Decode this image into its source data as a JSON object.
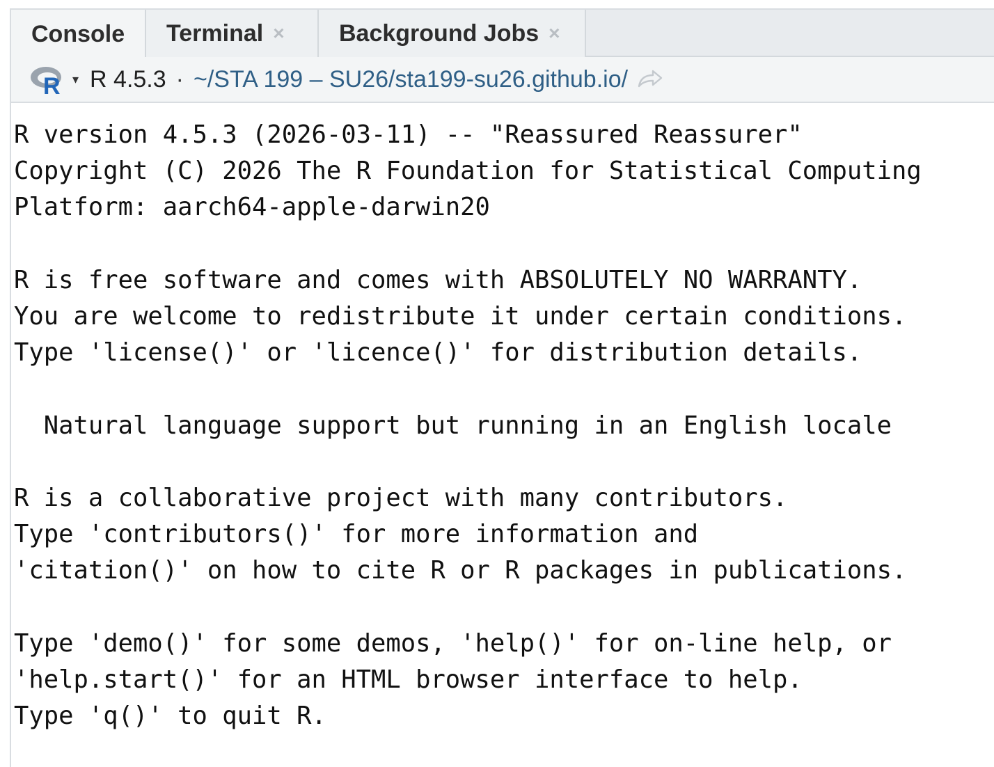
{
  "tabs": [
    {
      "label": "Console",
      "active": true,
      "closable": false
    },
    {
      "label": "Terminal",
      "active": false,
      "closable": true
    },
    {
      "label": "Background Jobs",
      "active": false,
      "closable": true
    }
  ],
  "tab_close_glyph": "×",
  "pathbar": {
    "r_icon": "r-logo-icon",
    "dropdown_glyph": "▾",
    "r_version": "R 4.5.3",
    "separator": "·",
    "path": "~/STA 199 – SU26/sta199-su26.github.io/",
    "goto_icon": "go-to-directory-icon"
  },
  "console": {
    "lines": [
      "R version 4.5.3 (2026-03-11) -- \"Reassured Reassurer\"",
      "Copyright (C) 2026 The R Foundation for Statistical Computing",
      "Platform: aarch64-apple-darwin20",
      "",
      "R is free software and comes with ABSOLUTELY NO WARRANTY.",
      "You are welcome to redistribute it under certain conditions.",
      "Type 'license()' or 'licence()' for distribution details.",
      "",
      "  Natural language support but running in an English locale",
      "",
      "R is a collaborative project with many contributors.",
      "Type 'contributors()' for more information and",
      "'citation()' on how to cite R or R packages in publications.",
      "",
      "Type 'demo()' for some demos, 'help()' for on-line help, or",
      "'help.start()' for an HTML browser interface to help.",
      "Type 'q()' to quit R."
    ]
  },
  "colors": {
    "path_text": "#2f5f86",
    "tabbar_bg": "#e8ebee",
    "r_logo_blue": "#2266b8",
    "r_logo_gray": "#9aa3ad"
  }
}
